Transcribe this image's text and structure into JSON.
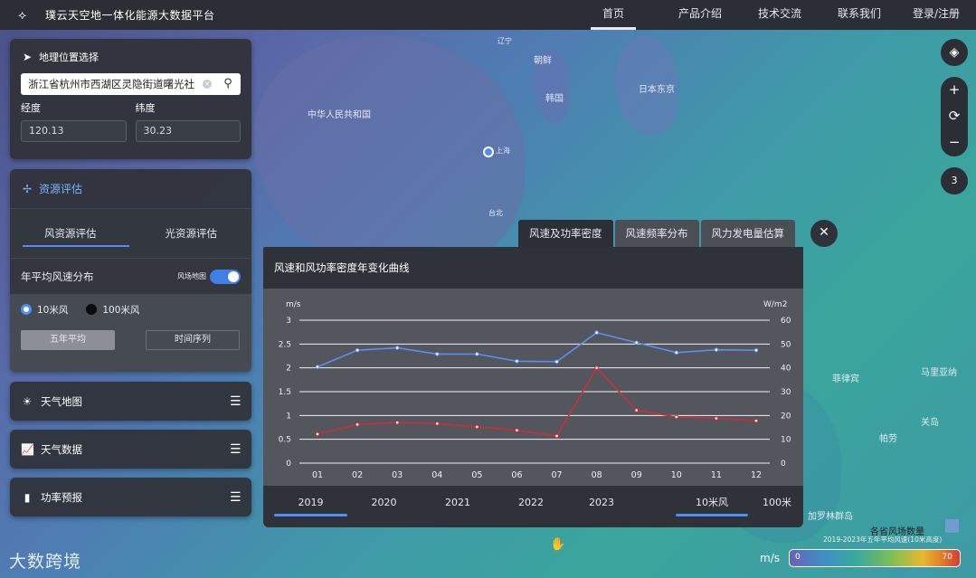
{
  "topbar": {
    "title": "璞云天空地一体化能源大数据平台",
    "nav": [
      {
        "label": "首页",
        "active": true
      },
      {
        "label": "产品介绍",
        "active": false
      },
      {
        "label": "技术交流",
        "active": false
      },
      {
        "label": "联系我们",
        "active": false
      },
      {
        "label": "登录/注册",
        "active": false
      }
    ]
  },
  "geo": {
    "header": "地理位置选择",
    "search_value": "浙江省杭州市西湖区灵隐街道曙光社",
    "lng_label": "经度",
    "lng_value": "120.13",
    "lat_label": "纬度",
    "lat_value": "30.23"
  },
  "resource": {
    "header": "资源评估",
    "tabs": [
      "风资源评估",
      "光资源评估"
    ],
    "active_tab": 0,
    "avg_label": "年平均风速分布",
    "toggle_label": "风场地图",
    "radio_10m": "10米风",
    "radio_100m": "100米风",
    "btn_avg": "五年平均",
    "btn_series": "时间序列"
  },
  "folds": {
    "weather_map": "天气地图",
    "weather_data": "天气数据",
    "power_forecast": "功率预报"
  },
  "chart_tabs": [
    "风速及功率密度",
    "风速频率分布",
    "风力发电量估算"
  ],
  "chart_panel": {
    "title": "风速和风功率密度年变化曲线",
    "years": [
      "2019",
      "2020",
      "2021",
      "2022",
      "2023"
    ],
    "active_year": "2019",
    "heights": [
      "10米风",
      "100米风"
    ],
    "active_height": "10米风"
  },
  "chart_data": {
    "type": "line",
    "title": "风速和风功率密度年变化曲线",
    "categories": [
      "01",
      "02",
      "03",
      "04",
      "05",
      "06",
      "07",
      "08",
      "09",
      "10",
      "11",
      "12"
    ],
    "y_left": {
      "unit": "m/s",
      "ylim": [
        0,
        3
      ],
      "ticks": [
        "0",
        "0.5",
        "1",
        "1.5",
        "2",
        "2.5",
        "3"
      ]
    },
    "y_right": {
      "unit": "W/m2",
      "ylim": [
        0,
        60
      ],
      "ticks": [
        "0",
        "10",
        "20",
        "30",
        "40",
        "50",
        "60"
      ]
    },
    "series": [
      {
        "color": "#5b8ff0",
        "axis": "left",
        "values": [
          2.02,
          2.37,
          2.42,
          2.29,
          2.29,
          2.14,
          2.13,
          2.74,
          2.53,
          2.32,
          2.38,
          2.37
        ]
      },
      {
        "color": "#c9303a",
        "axis": "right",
        "values": [
          12.2,
          16.2,
          17.0,
          16.6,
          15.2,
          13.8,
          11.4,
          40.0,
          22.2,
          19.4,
          18.8,
          17.8
        ]
      }
    ],
    "grid": true
  },
  "legend": {
    "unit": "m/s",
    "min": "0",
    "max": "70",
    "caption": "2019-2023年五年平均风速(10米高度)",
    "title": "各省风场数量"
  },
  "controls": {
    "three_label": "3"
  },
  "map_labels": {
    "korea_n": "朝鲜",
    "korea_s": "韩国",
    "japan": "日本东京",
    "china": "中华人民共和国",
    "shanghai": "上海",
    "taipei": "台北",
    "jilin": "辽宁",
    "philippines": "菲律宾",
    "mariana": "马里亚纳",
    "guam": "关岛",
    "palau": "帕劳",
    "carolines": "加罗林群岛"
  },
  "watermark": "大数跨境"
}
